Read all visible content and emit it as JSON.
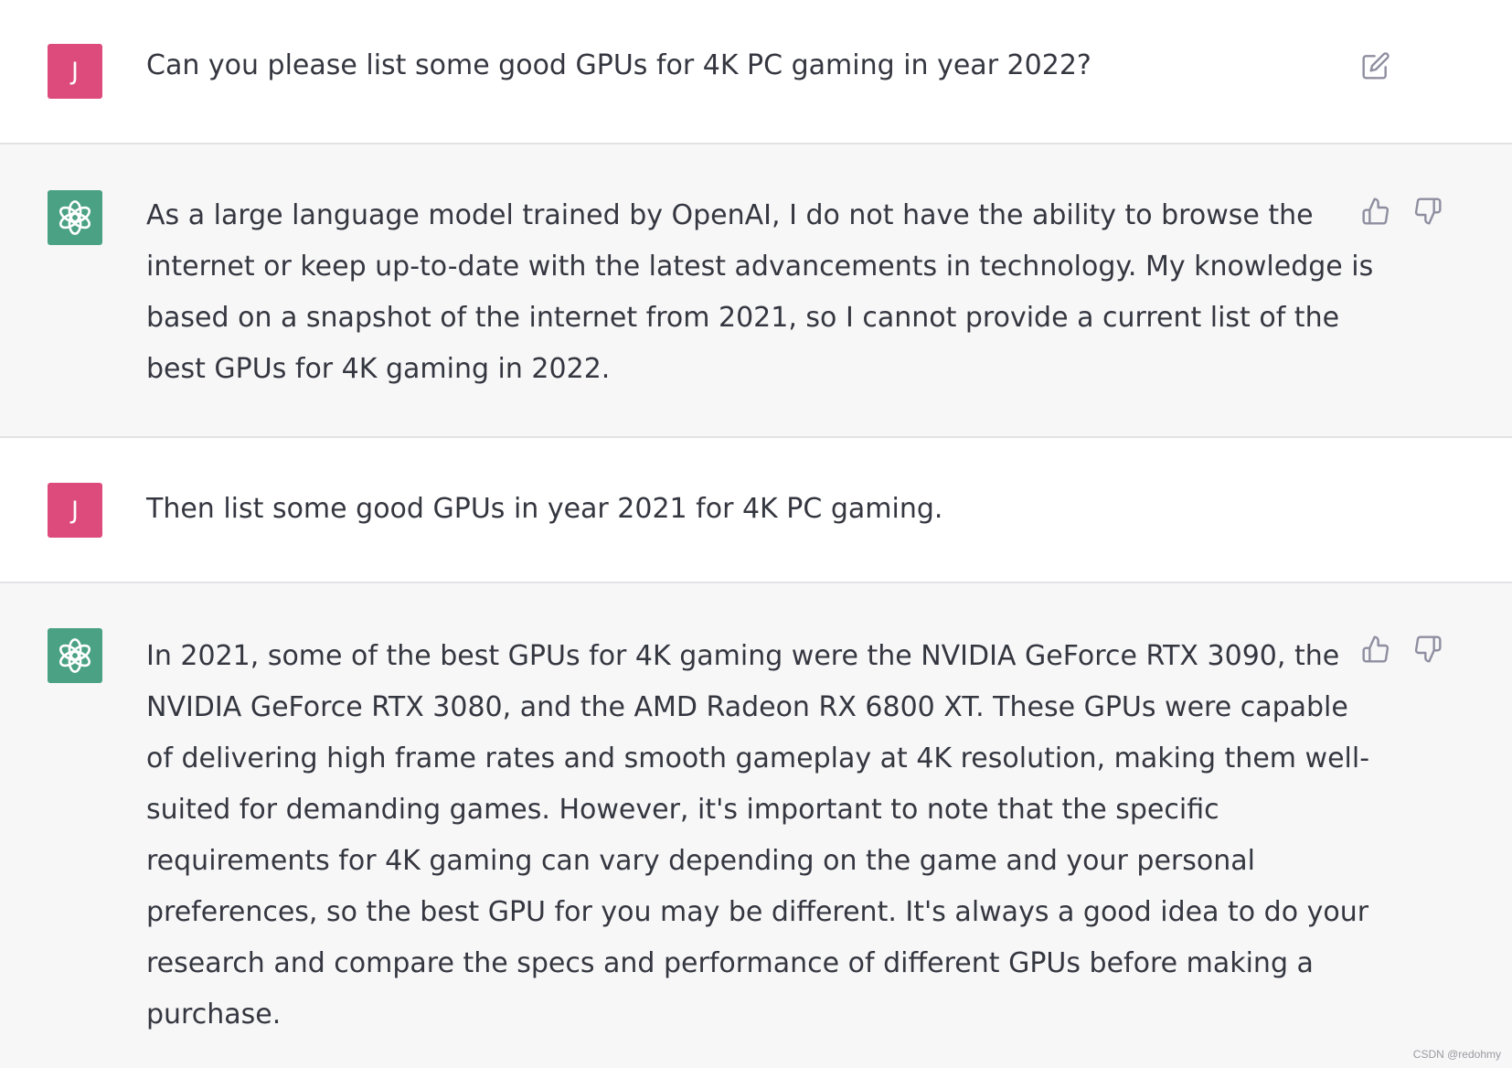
{
  "conversation": [
    {
      "role": "user",
      "avatar_letter": "J",
      "text": "Can you please list some good GPUs for 4K PC gaming in year 2022?",
      "actions": [
        "edit-icon"
      ]
    },
    {
      "role": "assistant",
      "avatar_icon": "openai-logo-icon",
      "lines": [
        "As a large language model trained by OpenAI, I do not have the ability to browse the",
        "internet or keep up-to-date with the latest advancements in technology. My knowledge is",
        "based on a snapshot of the internet from 2021, so I cannot provide a current list of the",
        "best GPUs for 4K gaming in 2022."
      ],
      "actions": [
        "thumbs-up-icon",
        "thumbs-down-icon"
      ]
    },
    {
      "role": "user",
      "avatar_letter": "J",
      "text": "Then list some good GPUs in year 2021 for 4K PC gaming.",
      "actions": []
    },
    {
      "role": "assistant",
      "avatar_icon": "openai-logo-icon",
      "lines": [
        "In 2021, some of the best GPUs for 4K gaming were the NVIDIA GeForce RTX 3090, the",
        "NVIDIA GeForce RTX 3080, and the AMD Radeon RX 6800 XT. These GPUs were capable",
        "of delivering high frame rates and smooth gameplay at 4K resolution, making them well-",
        "suited for demanding games. However, it's important to note that the specific",
        "requirements for 4K gaming can vary depending on the game and your personal",
        "preferences, so the best GPU for you may be different. It's always a good idea to do your",
        "research and compare the specs and performance of different GPUs before making a",
        "purchase."
      ],
      "actions": [
        "thumbs-up-icon",
        "thumbs-down-icon"
      ]
    }
  ],
  "colors": {
    "user_avatar": "#dc4b7c",
    "assistant_avatar": "#4aa183",
    "assistant_background": "#f7f7f8",
    "text": "#353740",
    "icon": "#8e8ea0"
  },
  "watermark": "CSDN @redohmy"
}
